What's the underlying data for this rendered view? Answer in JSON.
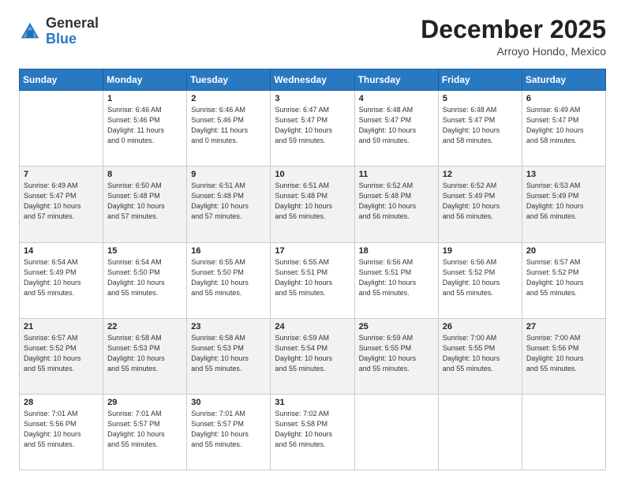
{
  "logo": {
    "general": "General",
    "blue": "Blue"
  },
  "header": {
    "month": "December 2025",
    "location": "Arroyo Hondo, Mexico"
  },
  "days_of_week": [
    "Sunday",
    "Monday",
    "Tuesday",
    "Wednesday",
    "Thursday",
    "Friday",
    "Saturday"
  ],
  "weeks": [
    [
      {
        "day": "",
        "info": ""
      },
      {
        "day": "1",
        "info": "Sunrise: 6:46 AM\nSunset: 5:46 PM\nDaylight: 11 hours\nand 0 minutes."
      },
      {
        "day": "2",
        "info": "Sunrise: 6:46 AM\nSunset: 5:46 PM\nDaylight: 11 hours\nand 0 minutes."
      },
      {
        "day": "3",
        "info": "Sunrise: 6:47 AM\nSunset: 5:47 PM\nDaylight: 10 hours\nand 59 minutes."
      },
      {
        "day": "4",
        "info": "Sunrise: 6:48 AM\nSunset: 5:47 PM\nDaylight: 10 hours\nand 59 minutes."
      },
      {
        "day": "5",
        "info": "Sunrise: 6:48 AM\nSunset: 5:47 PM\nDaylight: 10 hours\nand 58 minutes."
      },
      {
        "day": "6",
        "info": "Sunrise: 6:49 AM\nSunset: 5:47 PM\nDaylight: 10 hours\nand 58 minutes."
      }
    ],
    [
      {
        "day": "7",
        "info": "Sunrise: 6:49 AM\nSunset: 5:47 PM\nDaylight: 10 hours\nand 57 minutes."
      },
      {
        "day": "8",
        "info": "Sunrise: 6:50 AM\nSunset: 5:48 PM\nDaylight: 10 hours\nand 57 minutes."
      },
      {
        "day": "9",
        "info": "Sunrise: 6:51 AM\nSunset: 5:48 PM\nDaylight: 10 hours\nand 57 minutes."
      },
      {
        "day": "10",
        "info": "Sunrise: 6:51 AM\nSunset: 5:48 PM\nDaylight: 10 hours\nand 56 minutes."
      },
      {
        "day": "11",
        "info": "Sunrise: 6:52 AM\nSunset: 5:48 PM\nDaylight: 10 hours\nand 56 minutes."
      },
      {
        "day": "12",
        "info": "Sunrise: 6:52 AM\nSunset: 5:49 PM\nDaylight: 10 hours\nand 56 minutes."
      },
      {
        "day": "13",
        "info": "Sunrise: 6:53 AM\nSunset: 5:49 PM\nDaylight: 10 hours\nand 56 minutes."
      }
    ],
    [
      {
        "day": "14",
        "info": "Sunrise: 6:54 AM\nSunset: 5:49 PM\nDaylight: 10 hours\nand 55 minutes."
      },
      {
        "day": "15",
        "info": "Sunrise: 6:54 AM\nSunset: 5:50 PM\nDaylight: 10 hours\nand 55 minutes."
      },
      {
        "day": "16",
        "info": "Sunrise: 6:55 AM\nSunset: 5:50 PM\nDaylight: 10 hours\nand 55 minutes."
      },
      {
        "day": "17",
        "info": "Sunrise: 6:55 AM\nSunset: 5:51 PM\nDaylight: 10 hours\nand 55 minutes."
      },
      {
        "day": "18",
        "info": "Sunrise: 6:56 AM\nSunset: 5:51 PM\nDaylight: 10 hours\nand 55 minutes."
      },
      {
        "day": "19",
        "info": "Sunrise: 6:56 AM\nSunset: 5:52 PM\nDaylight: 10 hours\nand 55 minutes."
      },
      {
        "day": "20",
        "info": "Sunrise: 6:57 AM\nSunset: 5:52 PM\nDaylight: 10 hours\nand 55 minutes."
      }
    ],
    [
      {
        "day": "21",
        "info": "Sunrise: 6:57 AM\nSunset: 5:52 PM\nDaylight: 10 hours\nand 55 minutes."
      },
      {
        "day": "22",
        "info": "Sunrise: 6:58 AM\nSunset: 5:53 PM\nDaylight: 10 hours\nand 55 minutes."
      },
      {
        "day": "23",
        "info": "Sunrise: 6:58 AM\nSunset: 5:53 PM\nDaylight: 10 hours\nand 55 minutes."
      },
      {
        "day": "24",
        "info": "Sunrise: 6:59 AM\nSunset: 5:54 PM\nDaylight: 10 hours\nand 55 minutes."
      },
      {
        "day": "25",
        "info": "Sunrise: 6:59 AM\nSunset: 5:55 PM\nDaylight: 10 hours\nand 55 minutes."
      },
      {
        "day": "26",
        "info": "Sunrise: 7:00 AM\nSunset: 5:55 PM\nDaylight: 10 hours\nand 55 minutes."
      },
      {
        "day": "27",
        "info": "Sunrise: 7:00 AM\nSunset: 5:56 PM\nDaylight: 10 hours\nand 55 minutes."
      }
    ],
    [
      {
        "day": "28",
        "info": "Sunrise: 7:01 AM\nSunset: 5:56 PM\nDaylight: 10 hours\nand 55 minutes."
      },
      {
        "day": "29",
        "info": "Sunrise: 7:01 AM\nSunset: 5:57 PM\nDaylight: 10 hours\nand 55 minutes."
      },
      {
        "day": "30",
        "info": "Sunrise: 7:01 AM\nSunset: 5:57 PM\nDaylight: 10 hours\nand 55 minutes."
      },
      {
        "day": "31",
        "info": "Sunrise: 7:02 AM\nSunset: 5:58 PM\nDaylight: 10 hours\nand 56 minutes."
      },
      {
        "day": "",
        "info": ""
      },
      {
        "day": "",
        "info": ""
      },
      {
        "day": "",
        "info": ""
      }
    ]
  ]
}
